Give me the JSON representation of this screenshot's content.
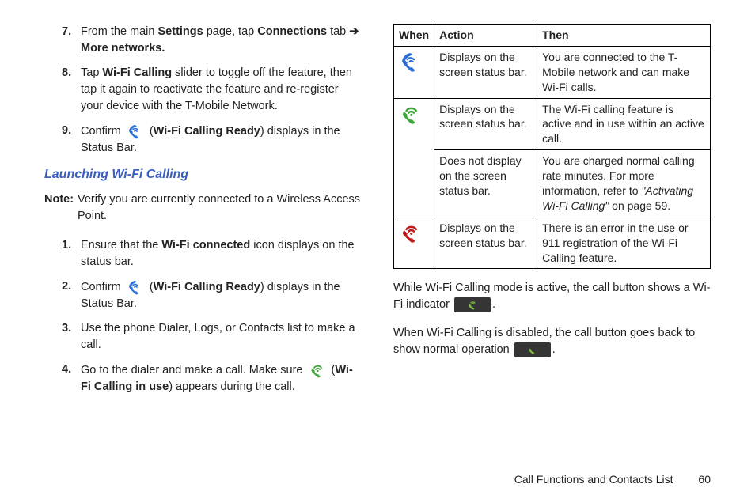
{
  "left": {
    "step7": {
      "num": "7.",
      "pre": "From the main ",
      "settings": "Settings",
      "mid": " page, tap ",
      "connections": "Connections",
      "tab": " tab ",
      "arrow": "➔",
      "more": "More networks."
    },
    "step8": {
      "num": "8.",
      "pre": "Tap ",
      "wfc": "Wi-Fi Calling",
      "post": " slider to toggle off the feature, then tap it again to reactivate the feature and re-register your device with the T-Mobile Network."
    },
    "step9": {
      "num": "9.",
      "pre": "Confirm ",
      "ready": "Wi-Fi Calling Ready",
      "post": ") displays in the Status Bar."
    },
    "heading": "Launching Wi-Fi Calling",
    "note": {
      "label": "Note:",
      "body": "Verify you are currently connected to a Wireless Access Point."
    },
    "l1": {
      "num": "1.",
      "pre": "Ensure that the ",
      "bold": "Wi-Fi connected",
      "post": " icon displays on the status bar."
    },
    "l2": {
      "num": "2.",
      "pre": "Confirm ",
      "ready": "Wi-Fi Calling Ready",
      "post": ") displays in the Status Bar."
    },
    "l3": {
      "num": "3.",
      "body": "Use the phone Dialer, Logs, or Contacts list to make a call."
    },
    "l4": {
      "num": "4.",
      "pre": "Go to the dialer and make a call. Make sure ",
      "inuse": "Wi-Fi Calling in use",
      "post": ") appears during the call."
    }
  },
  "table": {
    "h1": "When",
    "h2": "Action",
    "h3": "Then",
    "r1a": "Displays on the screen status bar.",
    "r1b": "You are connected to the T-Mobile network and can make Wi-Fi calls.",
    "r2a": "Displays on the screen status bar.",
    "r2b": "The Wi-Fi calling feature is active and in use within an active call.",
    "r3a": "Does not display on the screen status bar.",
    "r3b_pre": "You are charged normal calling rate minutes. For more information, refer to ",
    "r3b_ref": "\"Activating Wi-Fi Calling\"",
    "r3b_post": "  on page 59.",
    "r4a": "Displays on the screen status bar.",
    "r4b": "There is an error in the use or 911 registration of the Wi-Fi Calling feature."
  },
  "right": {
    "p1a": "While Wi-Fi Calling mode is active, the call button shows a Wi-Fi indicator ",
    "p1b": ".",
    "p2a": "When Wi-Fi Calling is disabled, the call button goes back to show normal operation ",
    "p2b": "."
  },
  "footer": {
    "section": "Call Functions and Contacts List",
    "page": "60"
  }
}
